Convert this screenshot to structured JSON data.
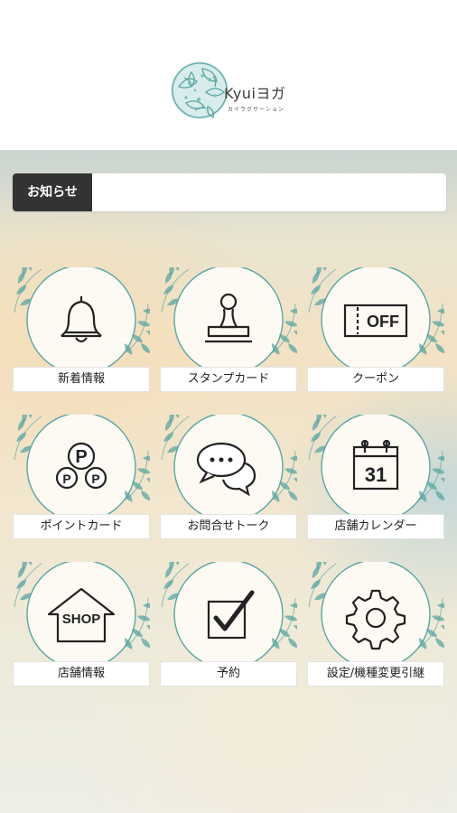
{
  "header": {
    "logo": {
      "brand": "Kyuiヨガ",
      "tagline": "カイラグサーション"
    }
  },
  "news": {
    "label": "お知らせ",
    "text": ""
  },
  "menu": {
    "items": [
      {
        "label": "新着情報",
        "icon": "bell-icon"
      },
      {
        "label": "スタンプカード",
        "icon": "stamp-icon"
      },
      {
        "label": "クーポン",
        "icon": "coupon-icon",
        "icon_text": "OFF"
      },
      {
        "label": "ポイントカード",
        "icon": "points-icon",
        "icon_text": "P"
      },
      {
        "label": "お問合せトーク",
        "icon": "chat-icon"
      },
      {
        "label": "店舗カレンダー",
        "icon": "calendar-icon",
        "icon_text": "31"
      },
      {
        "label": "店舗情報",
        "icon": "shop-icon",
        "icon_text": "SHOP"
      },
      {
        "label": "予約",
        "icon": "checkbox-icon"
      },
      {
        "label": "設定/機種変更引継",
        "icon": "gear-icon"
      }
    ]
  },
  "colors": {
    "accent_teal": "#5aa6a3",
    "label_bg": "#ffffff",
    "news_label_bg": "#333333"
  }
}
